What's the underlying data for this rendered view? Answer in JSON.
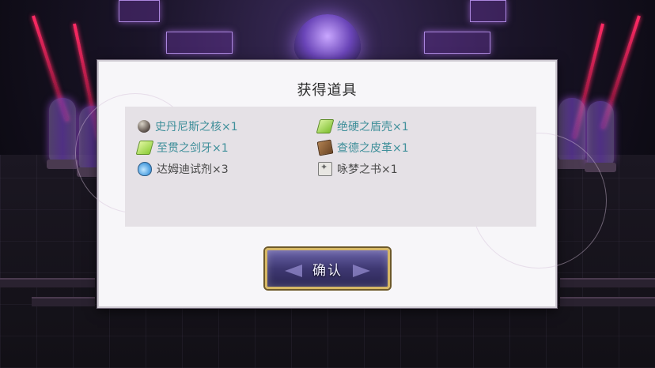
{
  "dialog": {
    "title": "获得道具",
    "confirm_label": "确认"
  },
  "items": [
    {
      "name": "史丹尼斯之核×1",
      "icon": "orb-icon",
      "color": "#3f8f9a"
    },
    {
      "name": "绝硬之盾壳×1",
      "icon": "shell-icon",
      "color": "#3f8f9a"
    },
    {
      "name": "至贯之剑牙×1",
      "icon": "fang-icon",
      "color": "#3f8f9a"
    },
    {
      "name": "查德之皮革×1",
      "icon": "leather-icon",
      "color": "#3f8f9a"
    },
    {
      "name": "达姆迪试剂×3",
      "icon": "flask-icon",
      "color": "#4a4a4a"
    },
    {
      "name": "咏梦之书×1",
      "icon": "book-icon",
      "color": "#4a4a4a"
    }
  ],
  "colors": {
    "accent_gold": "#d7b865",
    "button_purple": "#3e3872",
    "item_teal": "#3f8f9a"
  }
}
